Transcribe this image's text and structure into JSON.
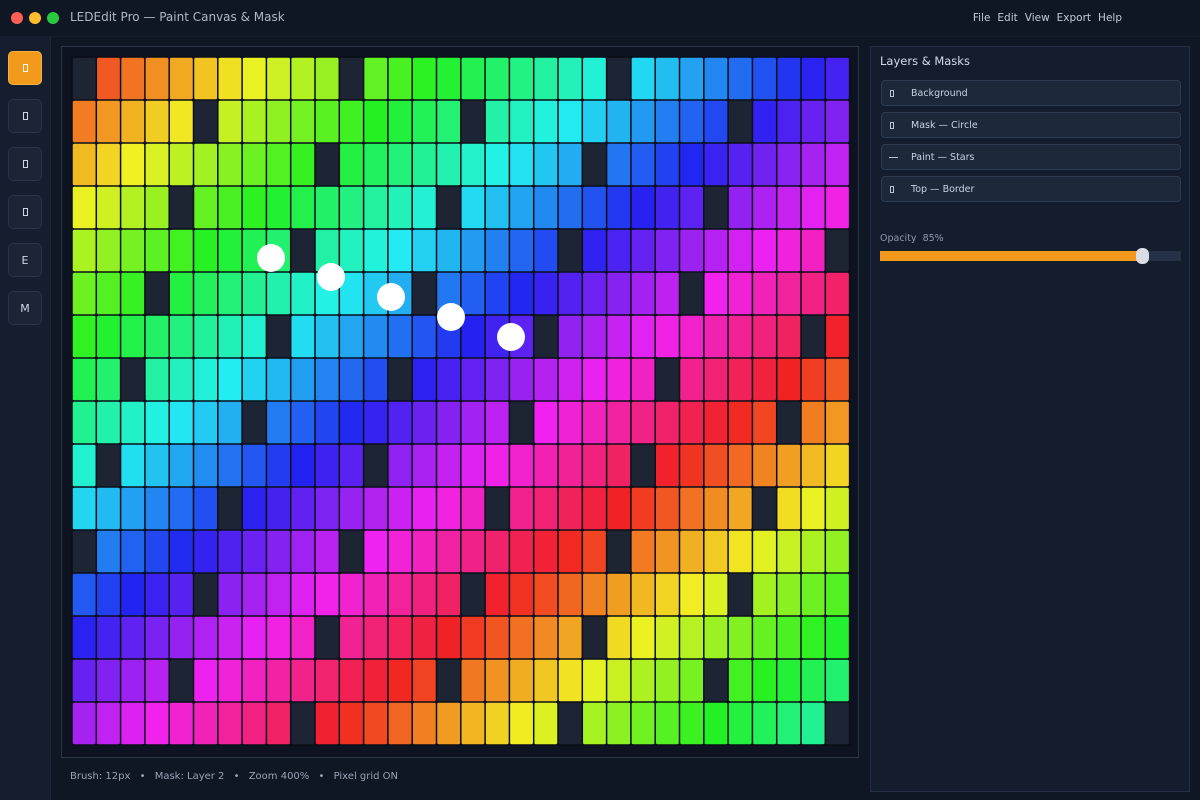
{
  "window": {
    "title": "LEDEdit Pro — Paint Canvas & Mask"
  },
  "menu": [
    "File",
    "Edit",
    "View",
    "Export",
    "Help"
  ],
  "toolbar": {
    "tools": [
      {
        "name": "paint-tool",
        "icon": "brush-icon",
        "label": "",
        "active": true
      },
      {
        "name": "fill-tool",
        "icon": "bucket-icon",
        "label": "",
        "active": false
      },
      {
        "name": "select-tool",
        "icon": "select-icon",
        "label": "",
        "active": false
      },
      {
        "name": "mask-tool",
        "icon": "mask-icon",
        "label": "",
        "active": false
      },
      {
        "name": "eraser-tool",
        "icon": "eraser-icon",
        "label": "E",
        "active": false
      },
      {
        "name": "move-tool",
        "icon": "move-icon",
        "label": "M",
        "active": false
      }
    ]
  },
  "canvas": {
    "grid_columns": 32,
    "grid_rows": 16,
    "palette": "hue-gradient",
    "off_color": "#1d2433",
    "mask_dots": 5
  },
  "status": {
    "brush": "Brush: 12px",
    "mask": "Mask: Layer 2",
    "zoom": "Zoom 400%",
    "grid": "Pixel grid ON",
    "separator": "•"
  },
  "panel": {
    "title": "Layers & Masks",
    "layers": [
      {
        "name": "Background",
        "icon": "image-icon"
      },
      {
        "name": "Mask — Circle",
        "icon": "mask-icon"
      },
      {
        "name": "Paint — Stars",
        "icon": "brush-icon"
      },
      {
        "name": "Top — Border",
        "icon": "border-icon"
      }
    ],
    "opacity_label": "Opacity",
    "opacity_value": "85%",
    "opacity_fraction": 0.87
  },
  "colors": {
    "accent": "#f29a1c",
    "background": "#0f1624",
    "panel": "#141d2d"
  }
}
